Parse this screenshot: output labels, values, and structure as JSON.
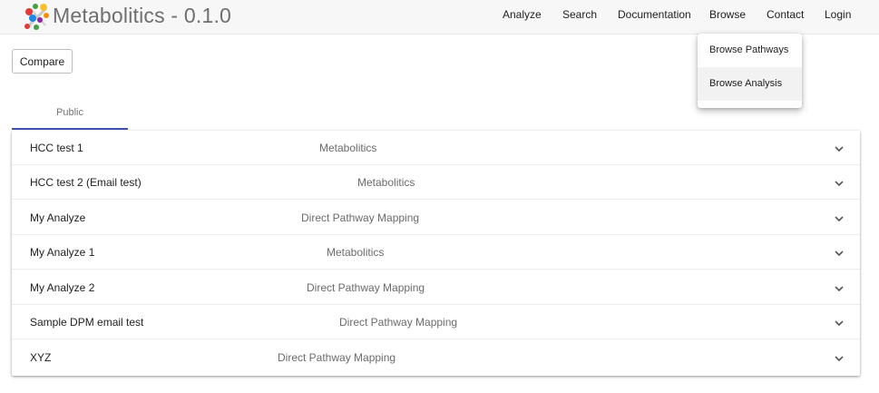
{
  "app": {
    "title": "Metabolitics - 0.1.0",
    "logo_icon": "molecule-logo-icon"
  },
  "nav": [
    {
      "label": "Analyze"
    },
    {
      "label": "Search"
    },
    {
      "label": "Documentation"
    },
    {
      "label": "Browse"
    },
    {
      "label": "Contact"
    },
    {
      "label": "Login"
    }
  ],
  "toolbar": {
    "compare_label": "Compare"
  },
  "tabs": [
    {
      "label": "Public",
      "active": true
    }
  ],
  "colors": {
    "accent": "#3f51b5",
    "topbar": "#f7f7f7"
  },
  "analyses": [
    {
      "name": "HCC test 1",
      "method": "Metabolitics"
    },
    {
      "name": "HCC test 2 (Email test)",
      "method": "Metabolitics"
    },
    {
      "name": "My Analyze",
      "method": "Direct Pathway Mapping"
    },
    {
      "name": "My Analyze 1",
      "method": "Metabolitics"
    },
    {
      "name": "My Analyze 2",
      "method": "Direct Pathway Mapping"
    },
    {
      "name": "Sample DPM email test",
      "method": "Direct Pathway Mapping"
    },
    {
      "name": "XYZ",
      "method": "Direct Pathway Mapping"
    }
  ],
  "browse_menu": {
    "items": [
      {
        "label": "Browse Pathways"
      },
      {
        "label": "Browse Analysis",
        "highlighted": true
      }
    ]
  },
  "row_icon": "chevron-down-icon"
}
